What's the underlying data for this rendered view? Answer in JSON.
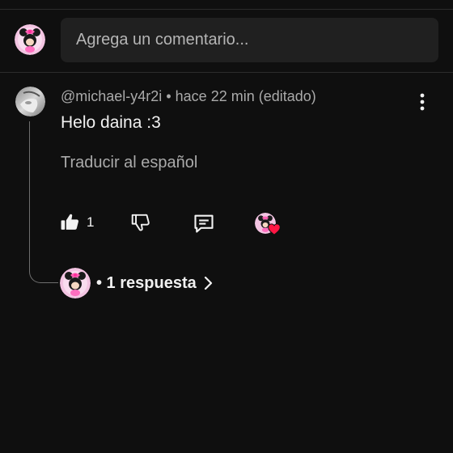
{
  "composer": {
    "placeholder": "Agrega un comentario..."
  },
  "comment": {
    "author": "@michael-y4r2i",
    "separator": "•",
    "time": "hace 22 min (editado)",
    "text": "Helo daina :3",
    "translate_label": "Traducir al español",
    "like_count": "1"
  },
  "replies": {
    "label": "• 1 respuesta"
  },
  "icons": {
    "menu": "more-vert-icon",
    "like": "thumb-up-filled-icon",
    "dislike": "thumb-down-outline-icon",
    "reply": "comment-reply-icon",
    "heart": "creator-heart-icon",
    "chevron": "chevron-right-icon"
  },
  "colors": {
    "background": "#0f0f0f",
    "input_background": "#202020",
    "primary_text": "#f1f1f1",
    "secondary_text": "#aaaaaa",
    "heart": "#ff1744",
    "avatar_pink": "#f6b8dc"
  }
}
